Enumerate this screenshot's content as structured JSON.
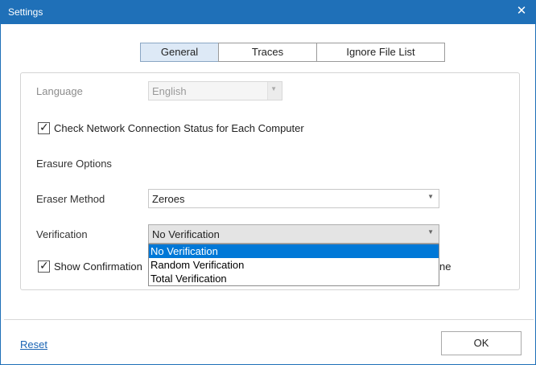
{
  "window": {
    "title": "Settings",
    "close_glyph": "✕"
  },
  "tabs": [
    {
      "label": "General",
      "active": true
    },
    {
      "label": "Traces",
      "active": false
    },
    {
      "label": "Ignore File List",
      "active": false
    }
  ],
  "language": {
    "label": "Language",
    "value": "English",
    "enabled": false
  },
  "check_network": {
    "label": "Check Network Connection Status for Each Computer",
    "checked": true
  },
  "erasure_options": {
    "heading": "Erasure Options"
  },
  "eraser_method": {
    "label": "Eraser Method",
    "value": "Zeroes"
  },
  "verification": {
    "label": "Verification",
    "value": "No Verification",
    "options": [
      "No Verification",
      "Random Verification",
      "Total Verification"
    ],
    "selected_index": 0
  },
  "show_confirmation": {
    "label_visible_start": "Show Confirmation ",
    "label_visible_end": "ne",
    "checked": true
  },
  "footer": {
    "reset_label": "Reset",
    "ok_label": "OK"
  },
  "icons": {
    "close": "close-icon",
    "check": "check-icon",
    "dropdown": "chevron-down-icon"
  },
  "colors": {
    "titlebar": "#1f70b8",
    "selection": "#0078d7",
    "active_tab": "#dde9f6",
    "link": "#1a64b4"
  }
}
